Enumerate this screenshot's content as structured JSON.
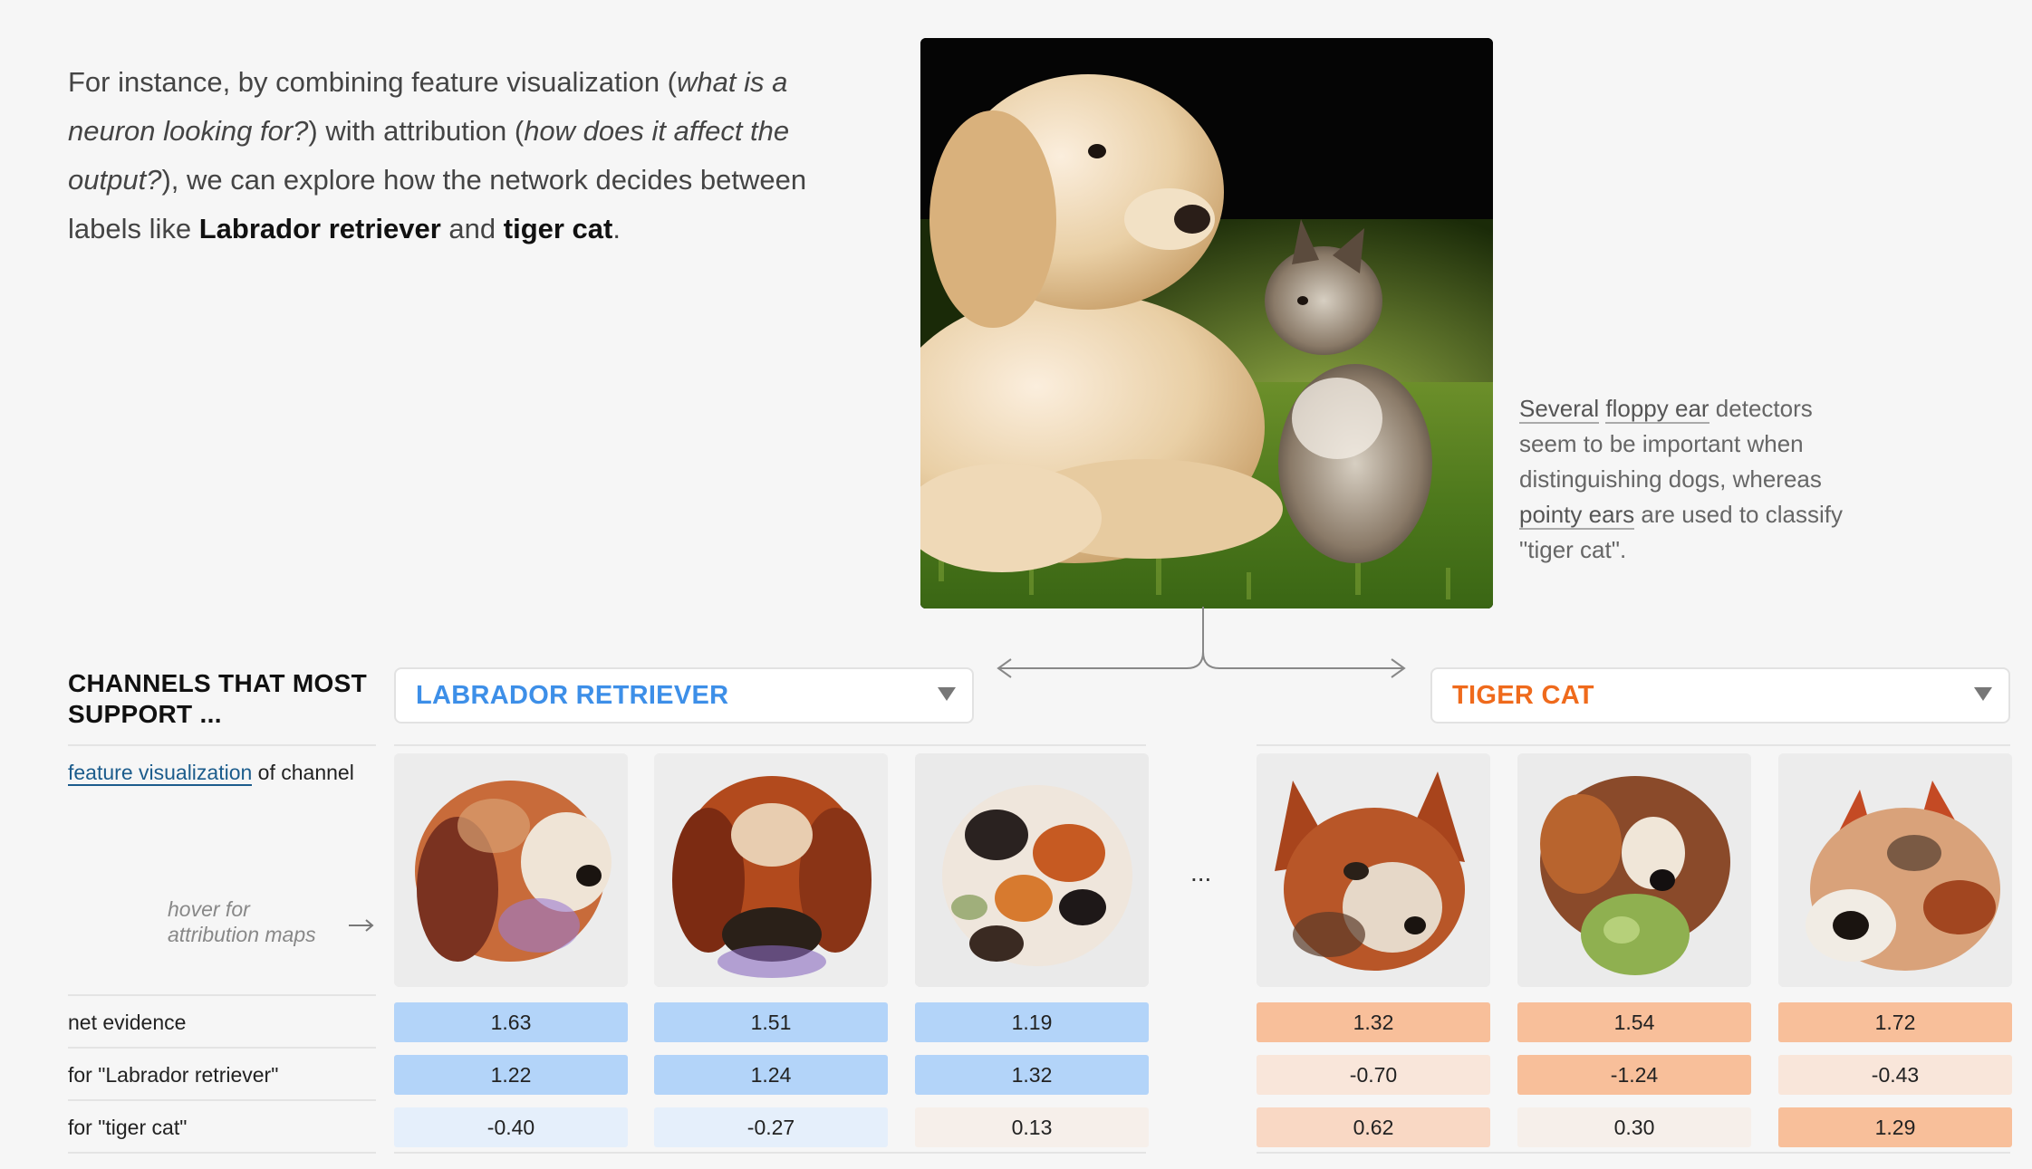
{
  "intro": {
    "p1": "For instance, by combining feature visualization (",
    "em1": "what is a neuron looking for?",
    "p2": ") with attribution (",
    "em2": "how does it affect the output?",
    "p3": "), we can explore how the network decides between labels like ",
    "b1": "Labrador retriever",
    "p4": " and ",
    "b2": "tiger cat",
    "p5": "."
  },
  "note": {
    "w1": "Several",
    "w2": "floppy ear",
    "t1": " detectors seem to be important when distinguishing dogs, whereas ",
    "w3": "pointy ears",
    "t2": " are used to classify \"tiger cat\"."
  },
  "heading": "CHANNELS THAT MOST SUPPORT ...",
  "dropdowns": {
    "left": {
      "label": "LABRADOR RETRIEVER",
      "color": "#3d8fe8"
    },
    "right": {
      "label": "TIGER CAT",
      "color": "#ef6a1c"
    }
  },
  "rows": {
    "feature_link": "feature visualization",
    "feature_rest": " of channel",
    "hover_line1": "hover for",
    "hover_line2": "attribution maps",
    "net": "net evidence",
    "lab": "for \"Labrador retriever\"",
    "cat": "for \"tiger cat\""
  },
  "ellipsis": "...",
  "channels": [
    {
      "net": "1.63",
      "lab": "1.22",
      "cat": "-0.40"
    },
    {
      "net": "1.51",
      "lab": "1.24",
      "cat": "-0.27"
    },
    {
      "net": "1.19",
      "lab": "1.32",
      "cat": "0.13"
    },
    {
      "net": "1.32",
      "lab": "-0.70",
      "cat": "0.62"
    },
    {
      "net": "1.54",
      "lab": "-1.24",
      "cat": "0.30"
    },
    {
      "net": "1.72",
      "lab": "-0.43",
      "cat": "1.29"
    }
  ],
  "colors": {
    "blue_strong": "#b3d4f9",
    "blue_mid": "#bedbf9",
    "blue_light": "#e5effb",
    "orange_strong": "#f8bf9a",
    "orange_mid": "#f9d8c4",
    "orange_light": "#f9e6da",
    "neutral_light": "#f6efea"
  }
}
